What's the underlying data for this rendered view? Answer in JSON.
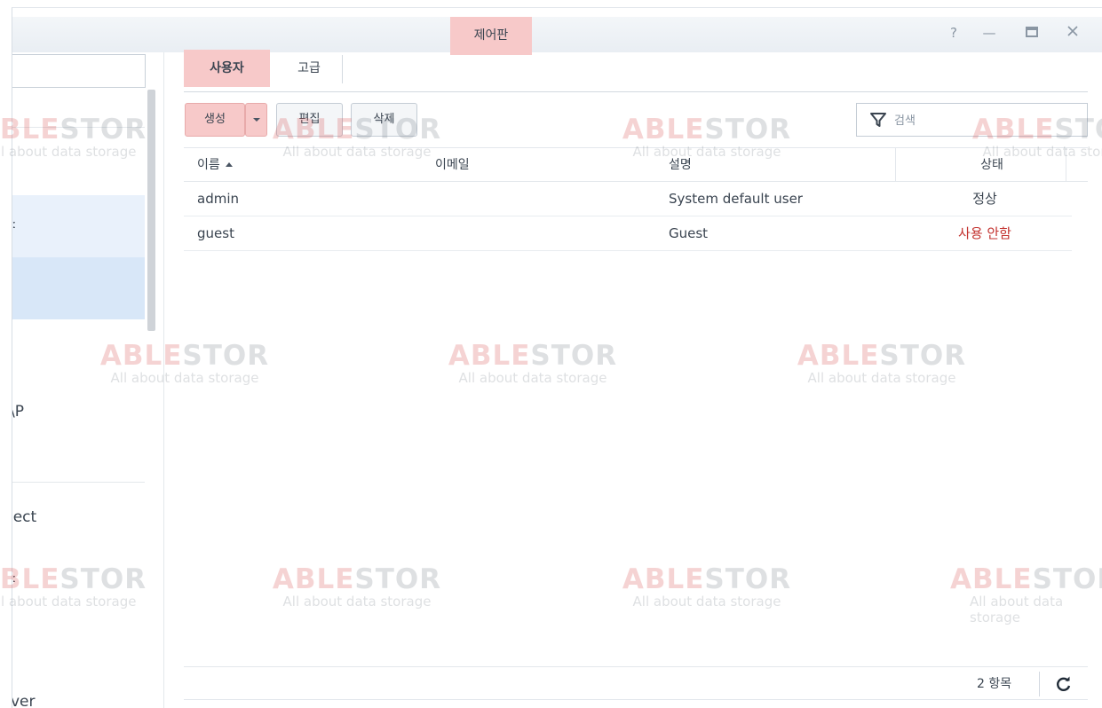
{
  "window": {
    "title": "제어판",
    "controls": {
      "help": "?",
      "minimize": "—",
      "maximize": "□",
      "close": "✕"
    }
  },
  "sidebar": {
    "search_value": "",
    "items": [
      {
        "label": "ː"
      },
      {
        "label": ""
      },
      {
        "label": "\\P"
      },
      {
        "label": "iect"
      },
      {
        "label": "ː"
      },
      {
        "label": "ver"
      }
    ]
  },
  "tabs": [
    {
      "label": "사용자",
      "active": true
    },
    {
      "label": "고급",
      "active": false
    }
  ],
  "toolbar": {
    "create_label": "생성",
    "edit_label": "편집",
    "delete_label": "삭제",
    "search_placeholder": "검색"
  },
  "table": {
    "columns": [
      "이름",
      "이메일",
      "설명",
      "상태"
    ],
    "sort_column": "이름",
    "rows": [
      {
        "name": "admin",
        "email": "",
        "description": "System default user",
        "status": "정상"
      },
      {
        "name": "guest",
        "email": "",
        "description": "Guest",
        "status": "사용 안함"
      }
    ]
  },
  "footer": {
    "count": "2 항목"
  },
  "watermark": {
    "brand_a": "ABLE",
    "brand_b": "STOR",
    "tagline": "All about data storage"
  },
  "colors": {
    "accent_highlight": "#f7c9c9",
    "status_disabled": "#c3322f",
    "selection": "#d8e7f8"
  }
}
